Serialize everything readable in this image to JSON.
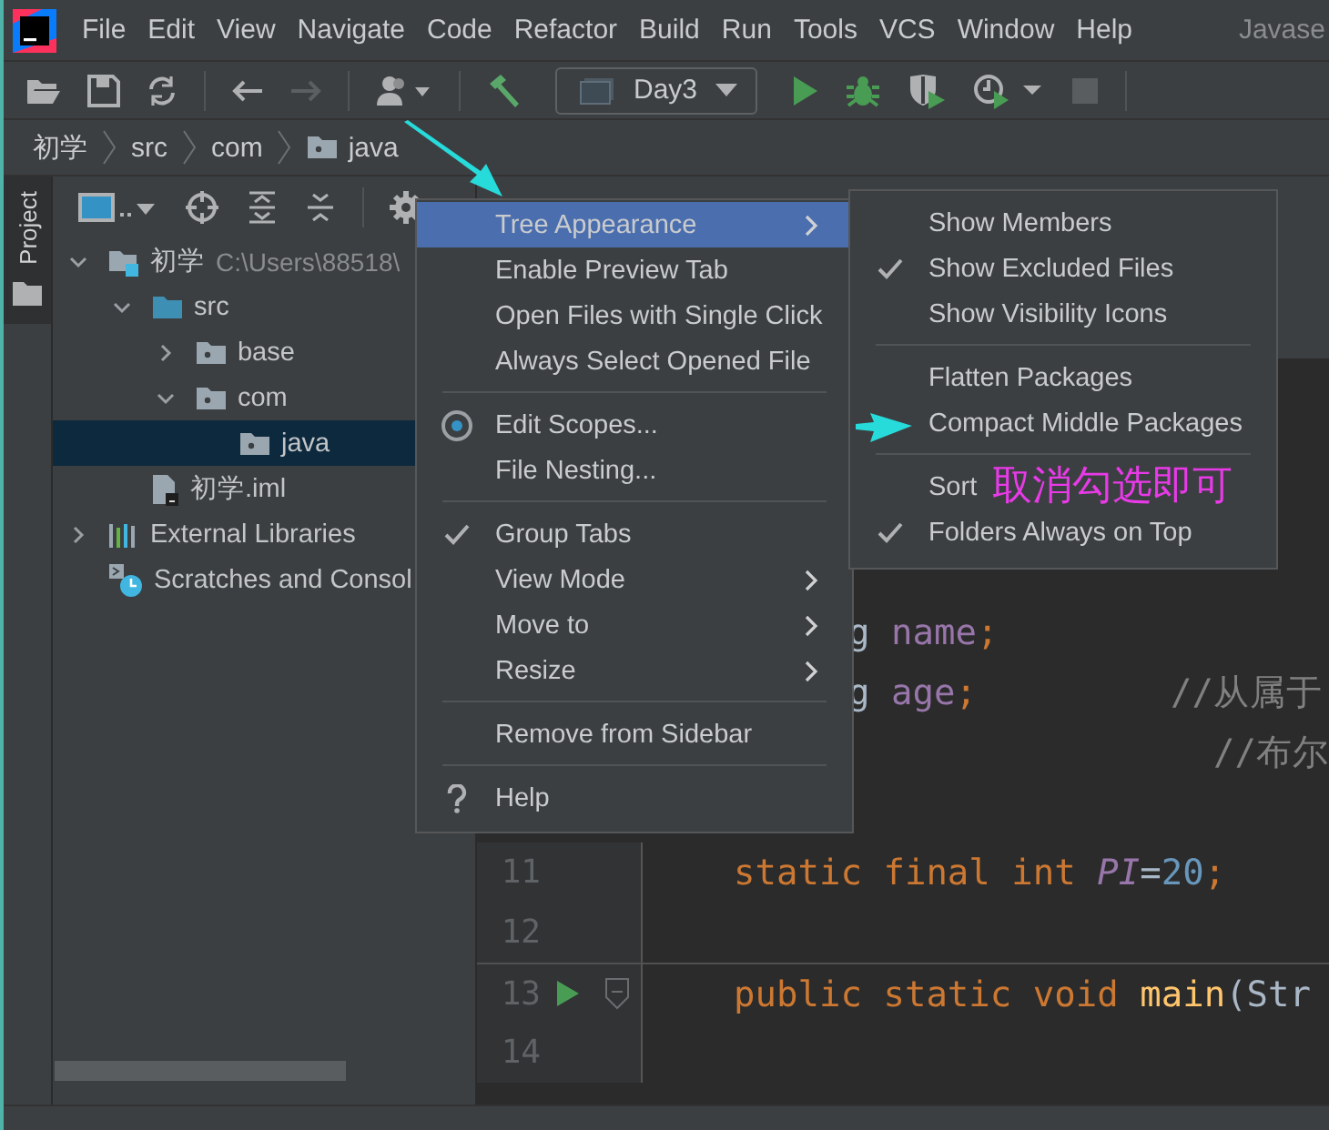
{
  "menubar": {
    "items": [
      "File",
      "Edit",
      "View",
      "Navigate",
      "Code",
      "Refactor",
      "Build",
      "Run",
      "Tools",
      "VCS",
      "Window",
      "Help"
    ],
    "project_title": "Javase"
  },
  "toolbar": {
    "run_config": "Day3"
  },
  "breadcrumbs": [
    "初学",
    "src",
    "com",
    "java"
  ],
  "side_tab": {
    "label": "Project",
    "selected": true
  },
  "project_tree": [
    {
      "label": "初学",
      "path": "C:\\Users\\88518\\",
      "kind": "module",
      "expanded": true,
      "selected": false,
      "children": [
        {
          "label": "src",
          "kind": "source",
          "expanded": true,
          "selected": false,
          "children": [
            {
              "label": "base",
              "kind": "package",
              "expanded": false,
              "selected": false
            },
            {
              "label": "com",
              "kind": "package",
              "expanded": true,
              "selected": false,
              "children": [
                {
                  "label": "java",
                  "kind": "package",
                  "selected": true
                }
              ]
            }
          ]
        },
        {
          "label": "初学.iml",
          "kind": "file",
          "selected": false
        }
      ]
    },
    {
      "label": "External Libraries",
      "kind": "libraries",
      "expanded": false,
      "selected": false
    },
    {
      "label": "Scratches and Consol",
      "kind": "scratches",
      "selected": false
    }
  ],
  "editor": {
    "covered_lines": [
      {
        "code": [
          {
            "text": "g ",
            "kind": "plain"
          },
          {
            "text": "name",
            "kind": "field"
          },
          {
            "text": ";",
            "kind": "keyword"
          }
        ]
      },
      {
        "code": [
          {
            "text": "g ",
            "kind": "plain"
          },
          {
            "text": "age",
            "kind": "field"
          },
          {
            "text": ";",
            "kind": "keyword"
          }
        ],
        "comment": "//从属于"
      },
      {
        "comment": "  //布尔"
      }
    ],
    "lines": [
      {
        "number": "11",
        "run_marker": false,
        "foldable": false,
        "separator_above": false,
        "code": [
          {
            "text": "static final int ",
            "kind": "keyword"
          },
          {
            "text": "PI",
            "kind": "constant"
          },
          {
            "text": "=",
            "kind": "plain"
          },
          {
            "text": "20",
            "kind": "number"
          },
          {
            "text": ";",
            "kind": "keyword"
          }
        ]
      },
      {
        "number": "12",
        "run_marker": false,
        "foldable": false,
        "separator_above": false
      },
      {
        "number": "13",
        "run_marker": true,
        "foldable": true,
        "separator_above": true,
        "code": [
          {
            "text": "public static void ",
            "kind": "keyword"
          },
          {
            "text": "main",
            "kind": "method"
          },
          {
            "text": "(Str",
            "kind": "plain"
          }
        ]
      },
      {
        "number": "14",
        "run_marker": false,
        "foldable": false,
        "separator_above": false
      }
    ]
  },
  "popup_menu": {
    "items": [
      {
        "label": "Tree Appearance",
        "kind": "item",
        "selected": true,
        "checked": false,
        "submenu": true
      },
      {
        "label": "Enable Preview Tab",
        "kind": "item",
        "selected": false,
        "checked": false,
        "submenu": false
      },
      {
        "label": "Open Files with Single Click",
        "kind": "item",
        "selected": false,
        "checked": false,
        "submenu": false
      },
      {
        "label": "Always Select Opened File",
        "kind": "item",
        "selected": false,
        "checked": false,
        "submenu": false
      },
      {
        "kind": "separator"
      },
      {
        "label": "Edit Scopes...",
        "kind": "scopes",
        "selected": false,
        "checked": false,
        "submenu": false
      },
      {
        "label": "File Nesting...",
        "kind": "item",
        "selected": false,
        "checked": false,
        "submenu": false
      },
      {
        "kind": "separator"
      },
      {
        "label": "Group Tabs",
        "kind": "item",
        "selected": false,
        "checked": true,
        "submenu": false
      },
      {
        "label": "View Mode",
        "kind": "item",
        "selected": false,
        "checked": false,
        "submenu": true
      },
      {
        "label": "Move to",
        "kind": "item",
        "selected": false,
        "checked": false,
        "submenu": true
      },
      {
        "label": "Resize",
        "kind": "item",
        "selected": false,
        "checked": false,
        "submenu": true
      },
      {
        "kind": "separator"
      },
      {
        "label": "Remove from Sidebar",
        "kind": "item",
        "selected": false,
        "checked": false,
        "submenu": false
      },
      {
        "kind": "separator"
      },
      {
        "label": "Help",
        "kind": "help",
        "selected": false,
        "checked": false,
        "submenu": false
      }
    ]
  },
  "submenu": {
    "items": [
      {
        "label": "Show Members",
        "kind": "item",
        "checked": false
      },
      {
        "label": "Show Excluded Files",
        "kind": "item",
        "checked": true
      },
      {
        "label": "Show Visibility Icons",
        "kind": "item",
        "checked": false
      },
      {
        "kind": "separator"
      },
      {
        "label": "Flatten Packages",
        "kind": "item",
        "checked": false
      },
      {
        "label": "Compact Middle Packages",
        "kind": "item",
        "checked": false
      },
      {
        "kind": "separator"
      },
      {
        "label": "Sort",
        "kind": "item",
        "checked": false
      },
      {
        "label": "Folders Always on Top",
        "kind": "item",
        "checked": true
      }
    ]
  },
  "annotation": {
    "text": "取消勾选即可"
  }
}
